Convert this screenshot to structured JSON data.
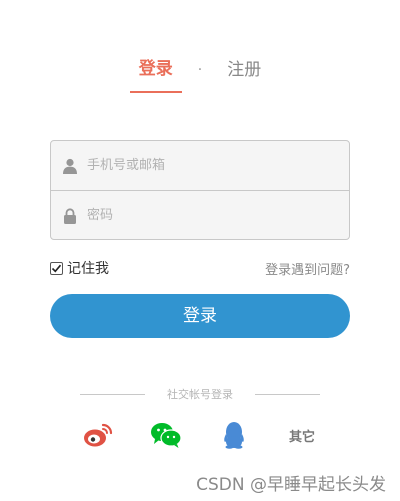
{
  "tabs": [
    {
      "label": "登录",
      "active": true
    },
    {
      "label": "注册",
      "active": false
    }
  ],
  "tab_separator": "·",
  "form": {
    "username_placeholder": "手机号或邮箱",
    "password_placeholder": "密码",
    "remember_label": "记住我",
    "remember_checked": true,
    "help_link": "登录遇到问题?",
    "submit_label": "登录"
  },
  "social": {
    "title": "社交帐号登录",
    "providers": [
      {
        "name": "weibo-icon",
        "color": "#e05244"
      },
      {
        "name": "wechat-icon",
        "color": "#00bb29"
      },
      {
        "name": "qq-icon",
        "color": "#498ad5"
      }
    ],
    "other_label": "其它"
  },
  "watermark": "CSDN @早睡早起长头发",
  "colors": {
    "accent": "#ea6f5a",
    "button": "#3194d0"
  }
}
